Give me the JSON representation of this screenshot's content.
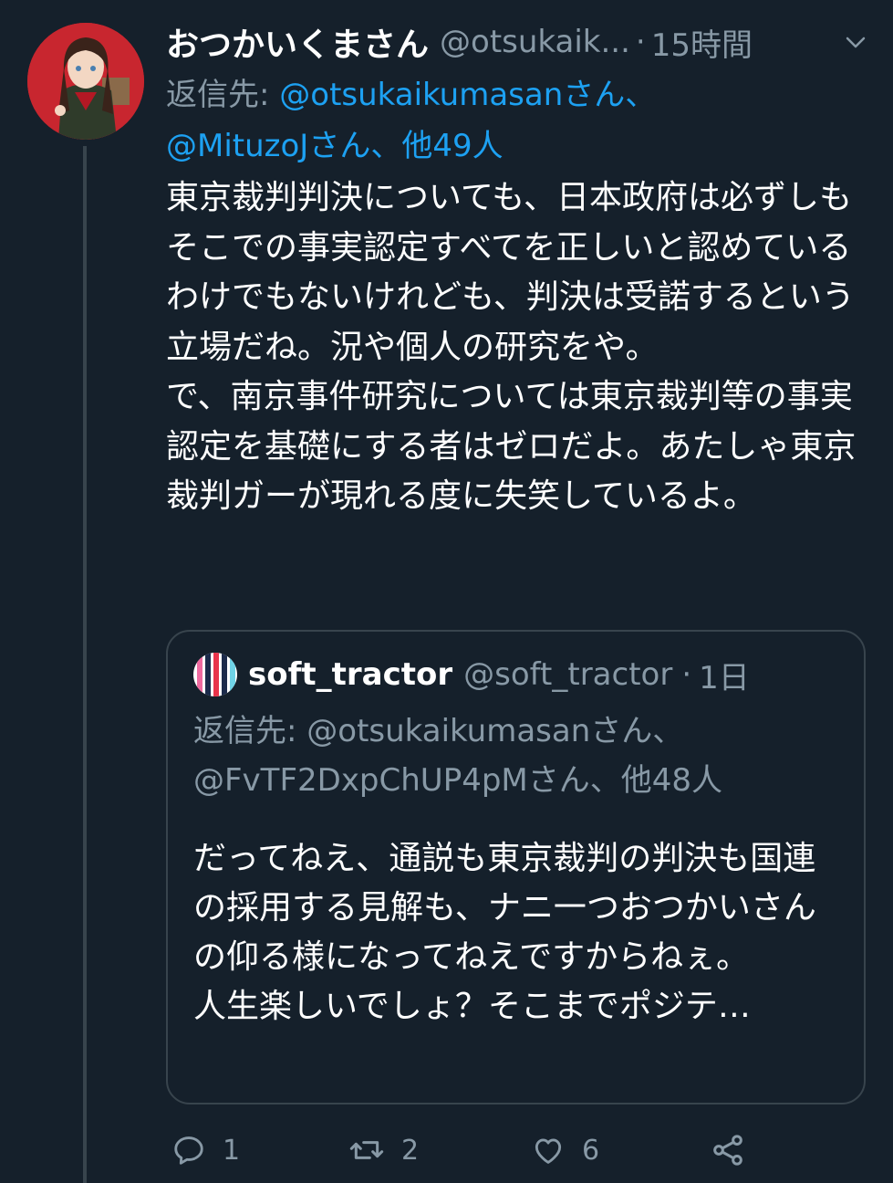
{
  "tweet": {
    "display_name": "おつかいくまさん",
    "handle": "@otsukaik...",
    "separator": "·",
    "time": "15時間",
    "replying_label": "返信先: ",
    "replying_mention_1": "@otsukaikumasanさん、",
    "replying_mention_2": "@MituzoJさん、他49人",
    "text": "東京裁判判決についても、日本政府は必ずしもそこでの事実認定すべてを正しいと認めているわけでもないけれども、判決は受諾するという立場だね。況や個人の研究をや。\nで、南京事件研究については東京裁判等の事実認定を基礎にする者はゼロだよ。あたしゃ東京裁判ガーが現れる度に失笑しているよ。"
  },
  "quoted": {
    "display_name": "soft_tractor",
    "handle": "@soft_tractor",
    "separator": "·",
    "time": "1日",
    "replying_label": "返信先: ",
    "replying_mentions": "@otsukaikumasanさん、@FvTF2DxpChUP4pMさん、他48人",
    "text": "だってねえ、通説も東京裁判の判決も国連の採用する見解も、ナニ一つおつかいさんの仰る様になってねえですからねぇ。\n人生楽しいでしょ？そこまでポジテ…"
  },
  "actions": {
    "reply_count": "1",
    "retweet_count": "2",
    "like_count": "6"
  },
  "icons": [
    "chevron-down-icon",
    "reply-icon",
    "retweet-icon",
    "heart-icon",
    "share-icon"
  ],
  "colors": {
    "background": "#15202b",
    "secondary_text": "#8899a6",
    "link": "#1da1f2",
    "border": "#38444d"
  }
}
